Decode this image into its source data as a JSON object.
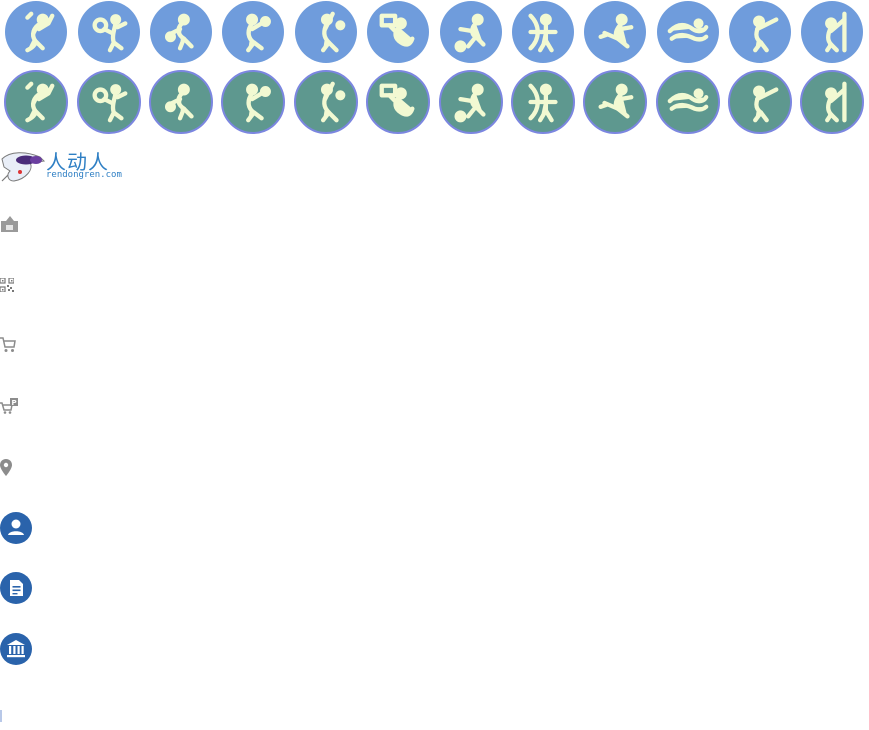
{
  "sport_icons": [
    "badminton-icon",
    "tennis-icon",
    "volleyball-icon",
    "handball-icon",
    "baseball-icon",
    "weightlifting-icon",
    "soccer-icon",
    "archery-icon",
    "figure-skating-icon",
    "swimming-icon",
    "shooting-icon",
    "gymnastics-icon"
  ],
  "colors": {
    "row1_disc": "#6f9cdc",
    "row2_disc": "#5e988f",
    "row2_ring": "#7b86e0",
    "figure_fill": "#f2f9d2",
    "gray_icon": "#8c8c8c",
    "blue_icon": "#2a63ab"
  },
  "logo": {
    "chinese": "人动人",
    "url": "rendongren.com"
  },
  "side_icons": [
    "lock-box-icon",
    "qr-code-icon",
    "shopping-cart-icon",
    "cart-parking-icon",
    "location-pin-icon",
    "user-circle-icon",
    "document-circle-icon",
    "bank-circle-icon"
  ]
}
